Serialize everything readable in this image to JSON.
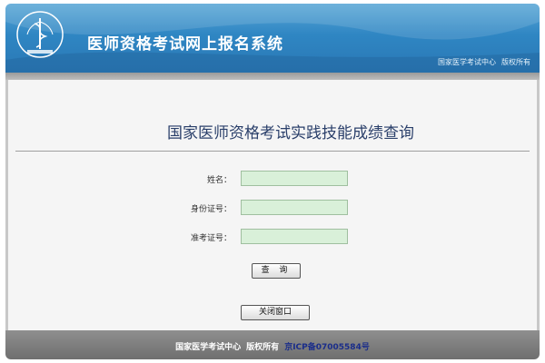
{
  "header": {
    "system_title": "医师资格考试网上报名系统",
    "right_org": "国家医学考试中心",
    "right_copyright": "版权所有"
  },
  "main": {
    "page_title": "国家医师资格考试实践技能成绩查询",
    "form": {
      "name_label": "姓名：",
      "id_label": "身份证号：",
      "ticket_label": "准考证号：",
      "name_value": "",
      "id_value": "",
      "ticket_value": ""
    },
    "query_button": "查 询",
    "close_button": "关闭窗口"
  },
  "footer": {
    "org": "国家医学考试中心",
    "rights": "版权所有",
    "icp": "京ICP备07005584号"
  },
  "colors": {
    "header_blue": "#2f86c3",
    "input_bg": "#d9f0d9",
    "title_text": "#2a3f6a"
  },
  "icons": [
    "caduceus-logo-icon"
  ]
}
